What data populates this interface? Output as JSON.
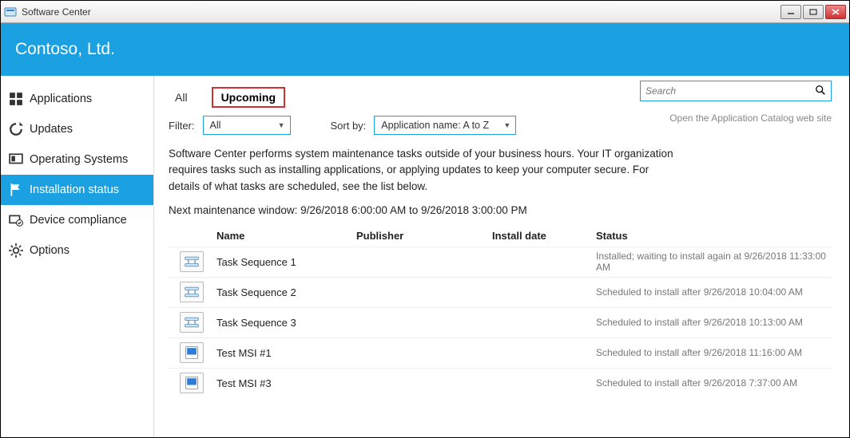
{
  "window": {
    "title": "Software Center"
  },
  "banner": {
    "org": "Contoso, Ltd."
  },
  "sidebar": {
    "items": [
      {
        "label": "Applications"
      },
      {
        "label": "Updates"
      },
      {
        "label": "Operating Systems"
      },
      {
        "label": "Installation status"
      },
      {
        "label": "Device compliance"
      },
      {
        "label": "Options"
      }
    ]
  },
  "tabs": {
    "all": "All",
    "upcoming": "Upcoming"
  },
  "search": {
    "placeholder": "Search"
  },
  "filter": {
    "label": "Filter:",
    "value": "All",
    "sort_label": "Sort by:",
    "sort_value": "Application name: A to Z"
  },
  "catalog_link": "Open the Application Catalog web site",
  "description": "Software Center performs system maintenance tasks outside of your business hours. Your IT organization requires tasks such as installing applications, or applying updates to keep your computer secure. For details of what tasks are scheduled, see the list below.",
  "maintenance": "Next maintenance window: 9/26/2018 6:00:00 AM to 9/26/2018 3:00:00 PM",
  "columns": {
    "name": "Name",
    "publisher": "Publisher",
    "install_date": "Install date",
    "status": "Status"
  },
  "rows": [
    {
      "icon": "ts",
      "name": "Task Sequence 1",
      "publisher": "",
      "install_date": "",
      "status": "Installed; waiting to install again at 9/26/2018 11:33:00 AM"
    },
    {
      "icon": "ts",
      "name": "Task Sequence 2",
      "publisher": "",
      "install_date": "",
      "status": "Scheduled to install after 9/26/2018 10:04:00 AM"
    },
    {
      "icon": "ts",
      "name": "Task Sequence 3",
      "publisher": "",
      "install_date": "",
      "status": "Scheduled to install after 9/26/2018 10:13:00 AM"
    },
    {
      "icon": "msi",
      "name": "Test MSI #1",
      "publisher": "",
      "install_date": "",
      "status": "Scheduled to install after 9/26/2018 11:16:00 AM"
    },
    {
      "icon": "msi",
      "name": "Test MSI #3",
      "publisher": "",
      "install_date": "",
      "status": "Scheduled to install after 9/26/2018 7:37:00 AM"
    }
  ]
}
